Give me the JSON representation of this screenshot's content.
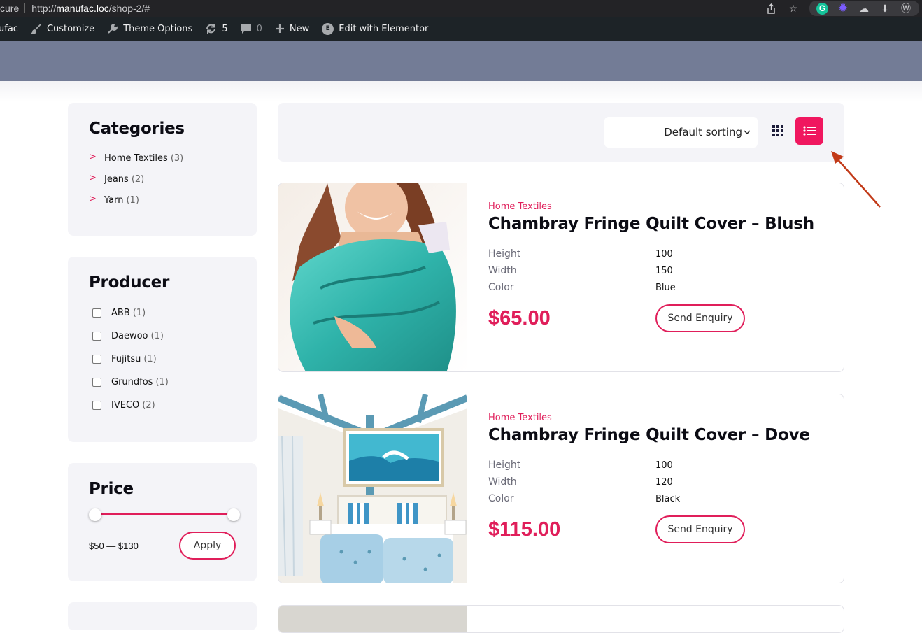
{
  "browser": {
    "security_label": "cure",
    "url_prefix": "http://",
    "url_host": "manufac.loc",
    "url_path": "/shop-2/#"
  },
  "admin_bar": {
    "site_name": "ufac",
    "customize": "Customize",
    "theme_options": "Theme Options",
    "updates_count": "5",
    "comments_count": "0",
    "new": "New",
    "elementor": "Edit with Elementor"
  },
  "sidebar": {
    "categories": {
      "title": "Categories",
      "items": [
        {
          "name": "Home Textiles",
          "count": "(3)"
        },
        {
          "name": "Jeans",
          "count": "(2)"
        },
        {
          "name": "Yarn",
          "count": "(1)"
        }
      ]
    },
    "producer": {
      "title": "Producer",
      "items": [
        {
          "name": "ABB",
          "count": "(1)"
        },
        {
          "name": "Daewoo",
          "count": "(1)"
        },
        {
          "name": "Fujitsu",
          "count": "(1)"
        },
        {
          "name": "Grundfos",
          "count": "(1)"
        },
        {
          "name": "IVECO",
          "count": "(2)"
        }
      ]
    },
    "price": {
      "title": "Price",
      "range_text": "$50 — $130",
      "apply_label": "Apply"
    }
  },
  "toolbar": {
    "sort_value": "Default sorting",
    "active_view": "list"
  },
  "products": [
    {
      "category": "Home Textiles",
      "title": "Chambray Fringe Quilt Cover – Blush",
      "attributes": [
        {
          "label": "Height",
          "value": "100"
        },
        {
          "label": "Width",
          "value": "150"
        },
        {
          "label": "Color",
          "value": "Blue"
        }
      ],
      "price": "$65.00",
      "button": "Send Enquiry"
    },
    {
      "category": "Home Textiles",
      "title": "Chambray Fringe Quilt Cover – Dove",
      "attributes": [
        {
          "label": "Height",
          "value": "100"
        },
        {
          "label": "Width",
          "value": "120"
        },
        {
          "label": "Color",
          "value": "Black"
        }
      ],
      "price": "$115.00",
      "button": "Send Enquiry"
    }
  ],
  "colors": {
    "accent": "#e01e5a",
    "hero": "#737c96",
    "admin_bar": "#1d2327"
  }
}
